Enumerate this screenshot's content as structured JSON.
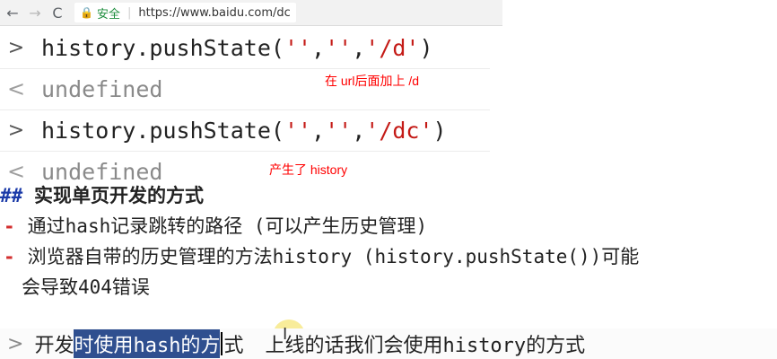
{
  "browser": {
    "back_glyph": "←",
    "forward_glyph": "→",
    "reload_glyph": "C",
    "lock_glyph": "🔒",
    "secure_label": "安全",
    "separator": "|",
    "url": "https://www.baidu.com/dc"
  },
  "console": {
    "prompt_glyph": ">",
    "result_glyph": "<",
    "rows": [
      {
        "fn": "history.pushState(",
        "a1": "''",
        "c1": ",",
        "a2": "''",
        "c2": ",",
        "a3": "'/d'",
        "end": ")"
      },
      {
        "result": "undefined"
      },
      {
        "fn": "history.pushState(",
        "a1": "''",
        "c1": ",",
        "a2": "''",
        "c2": ",",
        "a3": "'/dc'",
        "end": ")"
      },
      {
        "result": "undefined"
      }
    ],
    "annotations": [
      "在 url后面加上 /d",
      "产生了 history"
    ]
  },
  "markdown": {
    "heading_marker": "##",
    "heading_text": "实现单页开发的方式",
    "bullet_marker": "-",
    "item1": "通过hash记录跳转的路径 (可以产生历史管理)",
    "item2": "浏览器自带的历史管理的方法history (history.pushState())可能",
    "item2_cont": "会导致404错误",
    "bottom_prompt": ">",
    "bottom_pre": "开发",
    "bottom_selected": "时使用hash的方",
    "bottom_after": "式",
    "ibeam": "I",
    "bottom_rest": "上线的话我们会使用history的方式"
  },
  "colors": {
    "string": "#c41a16",
    "annotation": "#ff0000",
    "bullet": "#d32f2f",
    "heading_hash": "#1a3aa8",
    "selection": "#2f4f8f",
    "secure": "#1e8e3e"
  },
  "icons": [
    "back-arrow-icon",
    "forward-arrow-icon",
    "reload-icon",
    "lock-icon",
    "console-prompt-icon",
    "console-result-icon",
    "text-cursor-icon"
  ]
}
